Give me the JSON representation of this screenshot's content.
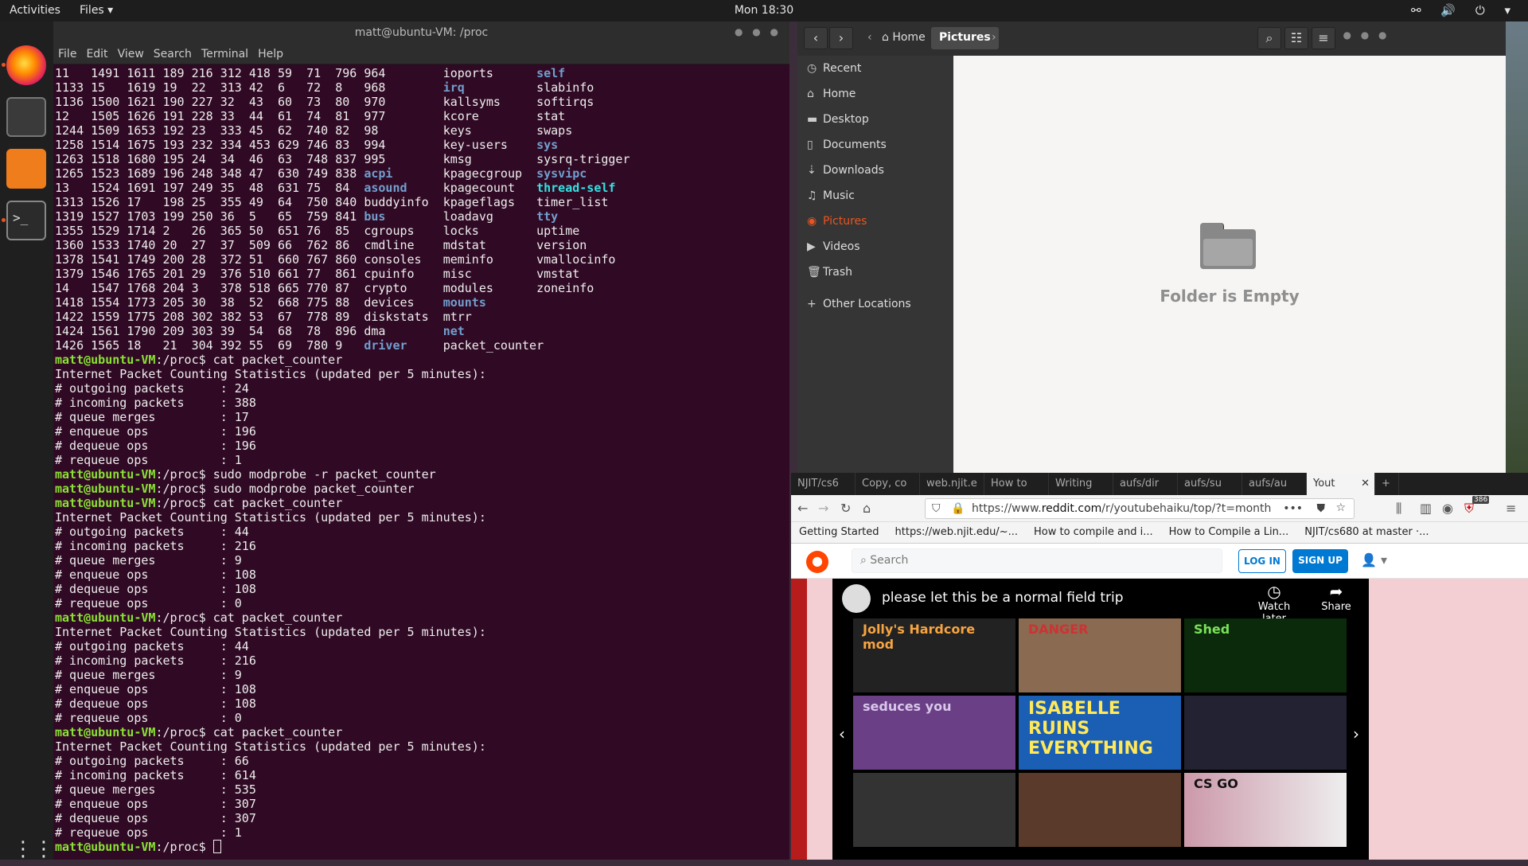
{
  "topbar": {
    "activities": "Activities",
    "app_menu": "Files ▾",
    "clock": "Mon 18:30",
    "tray": "⚯ 🔊 ⏻ ▾"
  },
  "dock": {
    "terminal_glyph": ">_",
    "show_apps": "⋮⋮⋮"
  },
  "terminal": {
    "title": "matt@ubuntu-VM: /proc",
    "menu": [
      "File",
      "Edit",
      "View",
      "Search",
      "Terminal",
      "Help"
    ],
    "ls_rows": [
      [
        "11",
        "1491",
        "1611",
        "189",
        "216",
        "312",
        "418",
        "59",
        "71",
        "796",
        "964",
        "ioports",
        "self"
      ],
      [
        "1133",
        "15",
        "1619",
        "19",
        "22",
        "313",
        "42",
        "6",
        "72",
        "8",
        "968",
        "irq",
        "slabinfo"
      ],
      [
        "1136",
        "1500",
        "1621",
        "190",
        "227",
        "32",
        "43",
        "60",
        "73",
        "80",
        "970",
        "kallsyms",
        "softirqs"
      ],
      [
        "12",
        "1505",
        "1626",
        "191",
        "228",
        "33",
        "44",
        "61",
        "74",
        "81",
        "977",
        "kcore",
        "stat"
      ],
      [
        "1244",
        "1509",
        "1653",
        "192",
        "23",
        "333",
        "45",
        "62",
        "740",
        "82",
        "98",
        "keys",
        "swaps"
      ],
      [
        "1258",
        "1514",
        "1675",
        "193",
        "232",
        "334",
        "453",
        "629",
        "746",
        "83",
        "994",
        "key-users",
        "sys"
      ],
      [
        "1263",
        "1518",
        "1680",
        "195",
        "24",
        "34",
        "46",
        "63",
        "748",
        "837",
        "995",
        "kmsg",
        "sysrq-trigger"
      ],
      [
        "1265",
        "1523",
        "1689",
        "196",
        "248",
        "348",
        "47",
        "630",
        "749",
        "838",
        "acpi",
        "kpagecgroup",
        "sysvipc"
      ],
      [
        "13",
        "1524",
        "1691",
        "197",
        "249",
        "35",
        "48",
        "631",
        "75",
        "84",
        "asound",
        "kpagecount",
        "thread-self"
      ],
      [
        "1313",
        "1526",
        "17",
        "198",
        "25",
        "355",
        "49",
        "64",
        "750",
        "840",
        "buddyinfo",
        "kpageflags",
        "timer_list"
      ],
      [
        "1319",
        "1527",
        "1703",
        "199",
        "250",
        "36",
        "5",
        "65",
        "759",
        "841",
        "bus",
        "loadavg",
        "tty"
      ],
      [
        "1355",
        "1529",
        "1714",
        "2",
        "26",
        "365",
        "50",
        "651",
        "76",
        "85",
        "cgroups",
        "locks",
        "uptime"
      ],
      [
        "1360",
        "1533",
        "1740",
        "20",
        "27",
        "37",
        "509",
        "66",
        "762",
        "86",
        "cmdline",
        "mdstat",
        "version"
      ],
      [
        "1378",
        "1541",
        "1749",
        "200",
        "28",
        "372",
        "51",
        "660",
        "767",
        "860",
        "consoles",
        "meminfo",
        "vmallocinfo"
      ],
      [
        "1379",
        "1546",
        "1765",
        "201",
        "29",
        "376",
        "510",
        "661",
        "77",
        "861",
        "cpuinfo",
        "misc",
        "vmstat"
      ],
      [
        "14",
        "1547",
        "1768",
        "204",
        "3",
        "378",
        "518",
        "665",
        "770",
        "87",
        "crypto",
        "modules",
        "zoneinfo"
      ],
      [
        "1418",
        "1554",
        "1773",
        "205",
        "30",
        "38",
        "52",
        "668",
        "775",
        "88",
        "devices",
        "mounts",
        ""
      ],
      [
        "1422",
        "1559",
        "1775",
        "208",
        "302",
        "382",
        "53",
        "67",
        "778",
        "89",
        "diskstats",
        "mtrr",
        ""
      ],
      [
        "1424",
        "1561",
        "1790",
        "209",
        "303",
        "39",
        "54",
        "68",
        "78",
        "896",
        "dma",
        "net",
        ""
      ],
      [
        "1426",
        "1565",
        "18",
        "21",
        "304",
        "392",
        "55",
        "69",
        "780",
        "9",
        "driver",
        "packet_counter",
        ""
      ]
    ],
    "blue_entries": [
      "self",
      "irq",
      "sys",
      "acpi",
      "asound",
      "bus",
      "driver",
      "sysvipc",
      "tty",
      "mounts",
      "net"
    ],
    "cyan_entries": [
      "thread-self"
    ],
    "prompt": "matt@ubuntu-VM",
    "prompt_path": ":/proc$ ",
    "stats_header": "Internet Packet Counting Statistics (updated per 5 minutes):",
    "labels": [
      "# outgoing packets     : ",
      "# incoming packets     : ",
      "# queue merges         : ",
      "# enqueue ops          : ",
      "# dequeue ops          : ",
      "# requeue ops          : "
    ],
    "blocks": [
      {
        "cmds": [
          "cat packet_counter"
        ],
        "values": [
          "24",
          "388",
          "17",
          "196",
          "196",
          "1"
        ]
      },
      {
        "cmds": [
          "sudo modprobe -r packet_counter",
          "sudo modprobe packet_counter",
          "cat packet_counter"
        ],
        "values": [
          "44",
          "216",
          "9",
          "108",
          "108",
          "0"
        ]
      },
      {
        "cmds": [
          "cat packet_counter"
        ],
        "values": [
          "44",
          "216",
          "9",
          "108",
          "108",
          "0"
        ]
      },
      {
        "cmds": [
          "cat packet_counter"
        ],
        "values": [
          "66",
          "614",
          "535",
          "307",
          "307",
          "1"
        ]
      }
    ]
  },
  "files": {
    "breadcrumbs": [
      "Home",
      "Pictures"
    ],
    "sidebar": [
      {
        "icon": "◷",
        "label": "Recent"
      },
      {
        "icon": "⌂",
        "label": "Home"
      },
      {
        "icon": "▬",
        "label": "Desktop"
      },
      {
        "icon": "▯",
        "label": "Documents"
      },
      {
        "icon": "⇣",
        "label": "Downloads"
      },
      {
        "icon": "♫",
        "label": "Music"
      },
      {
        "icon": "◉",
        "label": "Pictures"
      },
      {
        "icon": "▶",
        "label": "Videos"
      },
      {
        "icon": "🗑",
        "label": "Trash"
      },
      {
        "icon": "+",
        "label": "Other Locations"
      }
    ],
    "empty_message": "Folder is Empty"
  },
  "browser": {
    "tabs": [
      "NJIT/cs6",
      "Copy, co",
      "web.njit.e",
      "How to",
      "Writing",
      "aufs/dir",
      "aufs/su",
      "aufs/au",
      "Yout"
    ],
    "badge": "386",
    "url_prefix": "https://www.",
    "url_domain": "reddit.com",
    "url_path": "/r/youtubehaiku/top/?t=month",
    "bookmarks": [
      "Getting Started",
      "https://web.njit.edu/~...",
      "How to compile and i...",
      "How to Compile a Lin...",
      "NJIT/cs680 at master ·..."
    ],
    "reddit": {
      "search_placeholder": "Search",
      "login": "LOG IN",
      "signup": "SIGN UP",
      "video_title": "please let this be a normal field trip",
      "watch_later": "Watch later",
      "share": "Share",
      "thumbs": [
        "Jolly's Hardcore mod",
        "DANGER",
        "Shed",
        "seduces you",
        "ISABELLE RUINS EVERYTHING",
        "",
        "",
        "",
        "CS GO"
      ]
    }
  },
  "colors": {
    "ubuntu_orange": "#e95420",
    "terminal_bg": "#300a24",
    "prompt_green": "#8ae234",
    "dir_blue": "#729fcf",
    "reddit_blue": "#0079d3",
    "reddit_orange": "#ff4500"
  }
}
